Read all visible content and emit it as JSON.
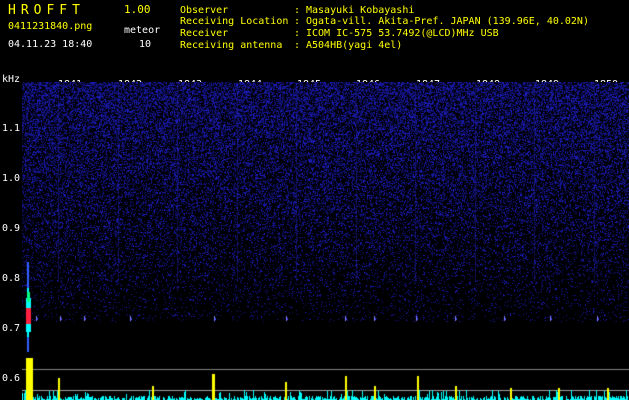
{
  "header": {
    "app_title": "HROFFT",
    "version": "1.00",
    "filename": "0411231840.png",
    "datetime": "04.11.23 18:40",
    "meteor_label": "meteor",
    "meteor_count": "10",
    "info": [
      {
        "label": "Observer",
        "value": "Masayuki Kobayashi"
      },
      {
        "label": "Receiving Location",
        "value": "Ogata-vill. Akita-Pref. JAPAN (139.96E, 40.02N)"
      },
      {
        "label": "Receiver",
        "value": "ICOM IC-575 53.7492(@LCD)MHz USB"
      },
      {
        "label": "Receiving antenna",
        "value": "A504HB(yagi 4el)"
      }
    ],
    "separator": ":"
  },
  "plot": {
    "y_unit": "kHz",
    "y_ticks": [
      "1.1",
      "1.0",
      "0.9",
      "0.8",
      "0.7",
      "0.6"
    ],
    "x_ticks": [
      "1841",
      "1842",
      "1843",
      "1844",
      "1845",
      "1846",
      "1847",
      "1848",
      "1849",
      "1850"
    ]
  },
  "colors": {
    "text_yellow": "#ffff00",
    "text_white": "#ffffff",
    "noise_blue": "#1010c0",
    "echo_cyan": "#00ffff",
    "echo_red": "#ff2040",
    "peak_yellow": "#ffff00"
  }
}
